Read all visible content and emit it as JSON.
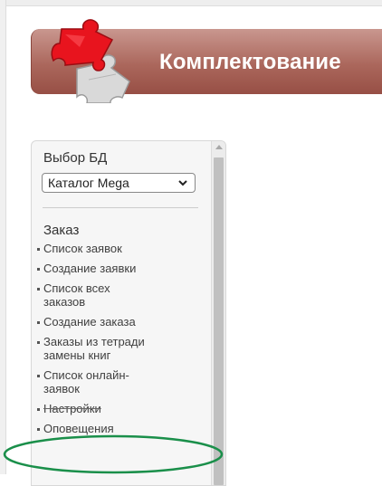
{
  "header": {
    "title": "Комплектование"
  },
  "sidebar": {
    "db_label": "Выбор БД",
    "db_select": {
      "value": "Каталог Mega"
    },
    "section_title": "Заказ",
    "items": [
      {
        "label": "Список заявок"
      },
      {
        "label": "Создание заявки"
      },
      {
        "label": "Список всех заказов"
      },
      {
        "label": "Создание заказа"
      },
      {
        "label": "Заказы из тетради замены книг"
      },
      {
        "label": "Список онлайн-заявок"
      },
      {
        "label": "Настройки"
      },
      {
        "label": "Оповещения"
      }
    ]
  },
  "colors": {
    "banner": "#ab675c",
    "puzzle_red": "#e8141e",
    "highlight_ellipse": "#1a8f4a"
  }
}
